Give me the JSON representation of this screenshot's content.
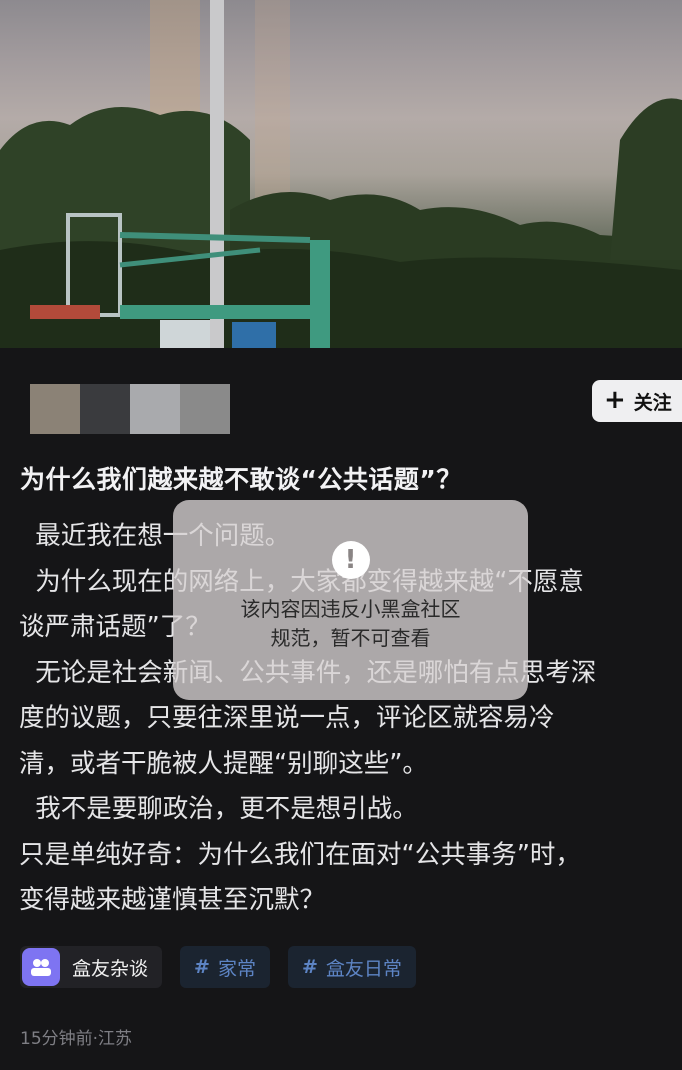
{
  "post": {
    "title": "为什么我们越来越不敢谈“公共话题”？",
    "body_lines": [
      "  最近我在想一个问题。",
      "  为什么现在的网络上，大家都变得越来越“不愿意",
      "谈严肃话题”了？",
      "  无论是社会新闻、公共事件，还是哪怕有点思考深",
      "度的议题，只要往深里说一点，评论区就容易冷",
      "清，或者干脆被人提醒“别聊这些”。",
      "  我不是要聊政治，更不是想引战。",
      "只是单纯好奇：为什么我们在面对“公共事务”时，",
      "变得越来越谨慎甚至沉默？"
    ],
    "meta": "15分钟前·江苏"
  },
  "author": {
    "follow_label": "关注",
    "avatar_block_colors": [
      "#8b8276",
      "#3a3b3e",
      "#a9aaad",
      "#8a8a8a"
    ]
  },
  "violation": {
    "icon": "!",
    "line1": "该内容因违反小黑盒社区",
    "line2": "规范，暂不可查看"
  },
  "tags": {
    "community": "盒友杂谈",
    "topics": [
      "家常",
      "盒友日常"
    ]
  },
  "colors": {
    "background": "#151517",
    "accent_tag_text": "#5d84c4",
    "community_avatar": "#7e74f2"
  }
}
